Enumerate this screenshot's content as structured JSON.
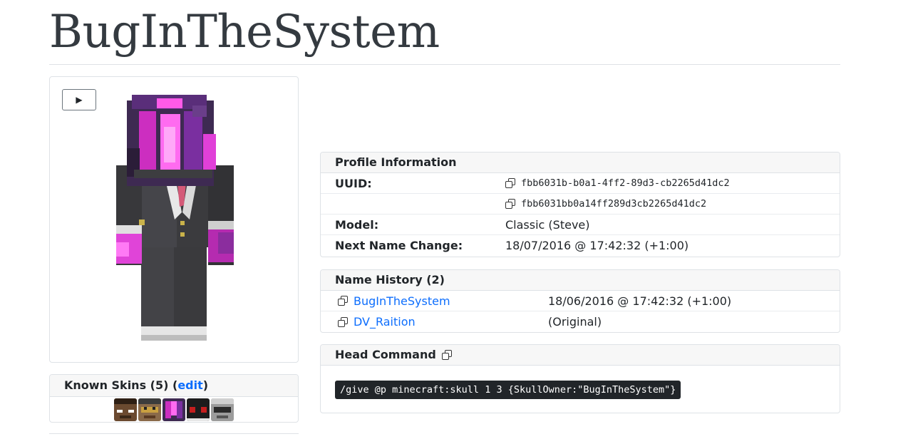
{
  "page": {
    "title": "BugInTheSystem"
  },
  "skin_viewer": {
    "play_label": "▶"
  },
  "known_skins": {
    "title": "Known Skins (5)",
    "edit_label": "edit",
    "open_paren": "(",
    "close_paren": ")"
  },
  "profile": {
    "header": "Profile Information",
    "uuid_label": "UUID:",
    "uuid": "fbb6031b-b0a1-4ff2-89d3-cb2265d41dc2",
    "uuid_short": "fbb6031bb0a14ff289d3cb2265d41dc2",
    "model_label": "Model:",
    "model": "Classic (Steve)",
    "next_change_label": "Next Name Change:",
    "next_change": "18/07/2016 @ 17:42:32 (+1:00)"
  },
  "name_history": {
    "header": "Name History (2)",
    "rows": [
      {
        "name": "BugInTheSystem",
        "date": "18/06/2016 @ 17:42:32 (+1:00)"
      },
      {
        "name": "DV_Raition",
        "date": "(Original)"
      }
    ]
  },
  "head_command": {
    "header": "Head Command",
    "command": "/give @p minecraft:skull 1 3 {SkullOwner:\"BugInTheSystem\"}"
  },
  "colors": {
    "accent": "#0d6efd",
    "magenta": "#e535e5",
    "suit": "#3b3b3e"
  }
}
